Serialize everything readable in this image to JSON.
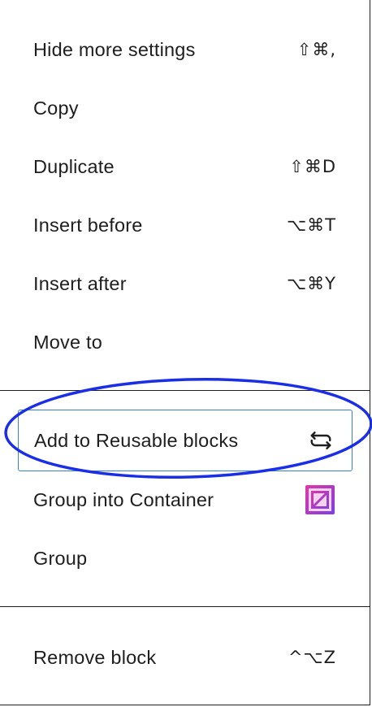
{
  "menu": {
    "group1": [
      {
        "label": "Hide more settings",
        "shortcut": "⇧⌘,"
      },
      {
        "label": "Copy",
        "shortcut": ""
      },
      {
        "label": "Duplicate",
        "shortcut": "⇧⌘D"
      },
      {
        "label": "Insert before",
        "shortcut": "⌥⌘T"
      },
      {
        "label": "Insert after",
        "shortcut": "⌥⌘Y"
      },
      {
        "label": "Move to",
        "shortcut": ""
      }
    ],
    "group2": [
      {
        "label": "Add to Reusable blocks",
        "icon": "reusable-block-icon"
      },
      {
        "label": "Group into Container",
        "icon": "container-block-icon"
      },
      {
        "label": "Group",
        "icon": ""
      }
    ],
    "group3": [
      {
        "label": "Remove block",
        "shortcut": "^⌥Z"
      }
    ]
  },
  "colors": {
    "focus_border": "#3582c4",
    "annotation_ellipse": "#1a2ee6",
    "container_icon_start": "#e236a6",
    "container_icon_end": "#7b3fe4",
    "text": "#1e1e1e"
  }
}
